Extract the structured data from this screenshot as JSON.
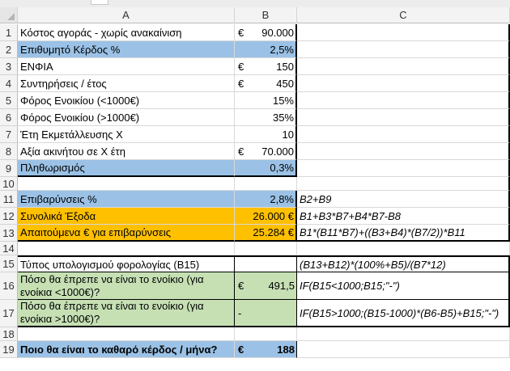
{
  "columns": [
    "A",
    "B",
    "C"
  ],
  "rows": [
    {
      "num": "1",
      "a": "Κόστος αγοράς - χωρίς ανακαίνιση",
      "cur": "€",
      "b": "90.000",
      "c": "",
      "fill": ""
    },
    {
      "num": "2",
      "a": "Επιθυμητό Κέρδος %",
      "cur": "",
      "b": "2,5%",
      "c": "",
      "fill": "blue"
    },
    {
      "num": "3",
      "a": "ΕΝΦΙΑ",
      "cur": "€",
      "b": "150",
      "c": "",
      "fill": ""
    },
    {
      "num": "4",
      "a": "Συντηρήσεις /  έτος",
      "cur": "€",
      "b": "450",
      "c": "",
      "fill": ""
    },
    {
      "num": "5",
      "a": "Φόρος Ενοικίου (<1000€)",
      "cur": "",
      "b": "15%",
      "c": "",
      "fill": ""
    },
    {
      "num": "6",
      "a": "Φόρος Ενοικίου (>1000€)",
      "cur": "",
      "b": "35%",
      "c": "",
      "fill": ""
    },
    {
      "num": "7",
      "a": "Έτη Εκμετάλλευσης Χ",
      "cur": "",
      "b": "10",
      "c": "",
      "fill": ""
    },
    {
      "num": "8",
      "a": "Αξία ακινήτου σε Χ έτη",
      "cur": "€",
      "b": "70.000",
      "c": "",
      "fill": ""
    },
    {
      "num": "9",
      "a": "Πληθωρισμός",
      "cur": "",
      "b": "0,3%",
      "c": "",
      "fill": "blue"
    },
    {
      "num": "10",
      "a": "",
      "cur": "",
      "b": "",
      "c": "",
      "fill": ""
    },
    {
      "num": "11",
      "a": "Επιβαρύνσεις %",
      "cur": "",
      "b": "2,8%",
      "c": "B2+B9",
      "fill": "blue"
    },
    {
      "num": "12",
      "a": "Συνολικά Έξοδα",
      "cur": "",
      "b": "26.000 €",
      "c": "B1+B3*B7+B4*B7-B8",
      "fill": "orange"
    },
    {
      "num": "13",
      "a": "Απαιτούμενα € για επιβαρύνσεις",
      "cur": "",
      "b": "25.284 €",
      "c": "B1*(B11*B7)+((B3+B4)*(B7/2))*B11",
      "fill": "orange"
    },
    {
      "num": "14",
      "a": "",
      "cur": "",
      "b": "",
      "c": "",
      "fill": ""
    },
    {
      "num": "15",
      "a": "Τύπος υπολογισμού φορολογίας (B15)",
      "cur": "",
      "b": "",
      "c": "(B13+B12)*(100%+B5)/(B7*12)",
      "fill": ""
    },
    {
      "num": "16",
      "a": "Πόσο θα έπρεπε να είναι το ενοίκιο (για ενοίκια <1000€)?",
      "cur": "€",
      "b": "491,5",
      "c": "IF(B15<1000;B15;\"-\")",
      "fill": "green"
    },
    {
      "num": "17",
      "a": "Πόσο θα έπρεπε να είναι το ενοίκιο (για ενοίκια >1000€)?",
      "cur": "-",
      "b": "",
      "c": "IF(B15>1000;(B15-1000)*(B6-B5)+B15;\"-\")",
      "fill": "green"
    },
    {
      "num": "18",
      "a": "",
      "cur": "",
      "b": "",
      "c": "",
      "fill": ""
    },
    {
      "num": "19",
      "a": "Ποιο θα είναι το καθαρό κέρδος / μήνα?",
      "cur": "€",
      "b": "188",
      "c": "",
      "fill": "blue"
    }
  ],
  "colors": {
    "blue": "#9bc2e6",
    "orange": "#ffc000",
    "green": "#c6e0b4"
  }
}
